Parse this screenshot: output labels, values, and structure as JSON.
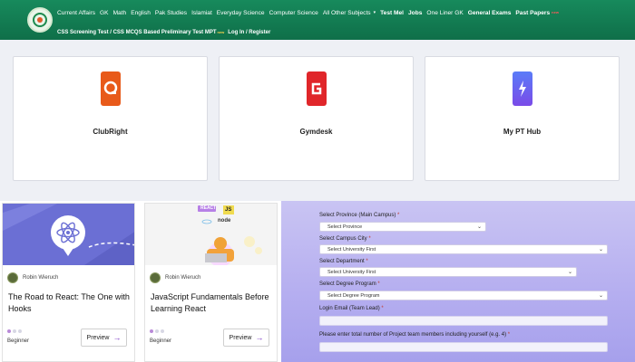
{
  "header": {
    "nav_top": [
      {
        "label": "Current Affairs"
      },
      {
        "label": "GK"
      },
      {
        "label": "Math"
      },
      {
        "label": "English"
      },
      {
        "label": "Pak Studies"
      },
      {
        "label": "Islamiat"
      },
      {
        "label": "Everyday Science"
      },
      {
        "label": "Computer Science"
      },
      {
        "label": "All Other Subjects"
      },
      {
        "label": "Test Mel"
      },
      {
        "label": "Jobs"
      },
      {
        "label": "One Liner GK"
      },
      {
        "label": "General Exams"
      },
      {
        "label": "Past Papers"
      }
    ],
    "nav_bottom": [
      {
        "label": "CSS Screening Test / CSS MCQS Based Preliminary Test MPT"
      },
      {
        "label": "Log In / Register"
      }
    ],
    "badge_new": "new",
    "colors": {
      "bar": "#0f6f49",
      "text": "#ffffff"
    }
  },
  "tools": [
    {
      "name": "ClubRight",
      "icon": "clubright-logo-icon",
      "color": "#e85a1a"
    },
    {
      "name": "Gymdesk",
      "icon": "gymdesk-logo-icon",
      "color": "#e0262a"
    },
    {
      "name": "My PT Hub",
      "icon": "mypthub-logo-icon",
      "color": "#6a5af9"
    }
  ],
  "courses": [
    {
      "author": "Robin Wieruch",
      "title": "The Road to React: The One with Hooks",
      "level": "Beginner",
      "preview": "Preview",
      "thumb": "react-atom-icon"
    },
    {
      "author": "Robin Wieruch",
      "title": "JavaScript Fundamentals Before Learning React",
      "level": "Beginner",
      "preview": "Preview",
      "thumb": "js-react-node-icon",
      "tags": [
        "REACT",
        "JS",
        "node"
      ]
    }
  ],
  "form": {
    "province_label": "Select Province (Main Campus)",
    "province_value": "Select Province",
    "campus_label": "Select Campus City",
    "campus_value": "Select University First",
    "department_label": "Select Department",
    "department_value": "Select University First",
    "program_label": "Select Degree Program",
    "program_value": "Select Degree Program",
    "email_label": "Login Email (Team Lead)",
    "members_label": "Please enter total number of Project team members including yourself (e.g. 4)",
    "required_mark": "*"
  }
}
